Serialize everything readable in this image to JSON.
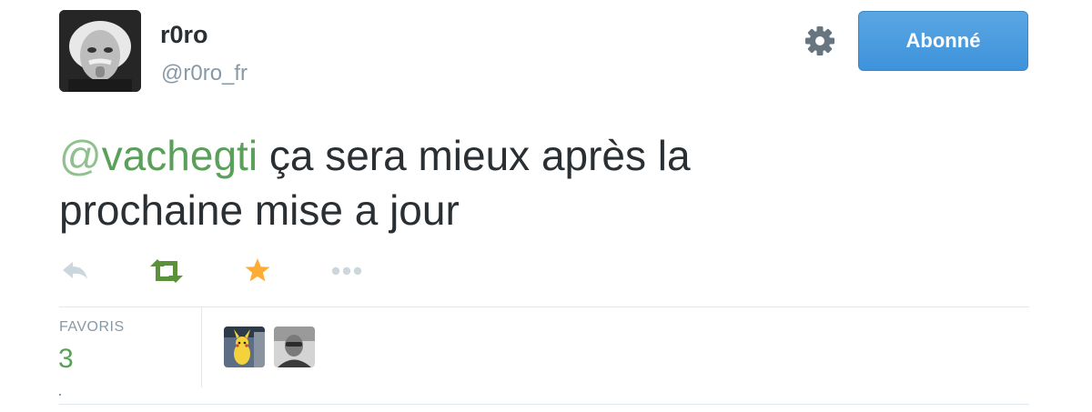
{
  "user": {
    "display_name": "r0ro",
    "screen_name": "@r0ro_fr",
    "avatar_icon": "einstein-avatar"
  },
  "header": {
    "settings_icon": "gear-icon",
    "follow_label": "Abonné"
  },
  "tweet": {
    "mention_at": "@",
    "mention_name": "vachegti",
    "text_line1": " ça sera mieux après la",
    "text_line2": "prochaine mise a jour"
  },
  "actions": [
    {
      "name": "reply",
      "icon": "reply-icon",
      "color": "#ccd6dd"
    },
    {
      "name": "retweet",
      "icon": "retweet-icon",
      "color": "#5c913b"
    },
    {
      "name": "favorite",
      "icon": "star-icon",
      "color": "#ffac33"
    },
    {
      "name": "more",
      "icon": "more-dots-icon",
      "color": "#ccd6dd"
    }
  ],
  "stats": {
    "favorites_label": "FAVORIS",
    "favorites_count": "3"
  },
  "favoriters": [
    {
      "icon": "pikachu-avatar"
    },
    {
      "icon": "person-avatar"
    }
  ],
  "colors": {
    "link": "#5aa05a",
    "button": "#4a9be0",
    "muted": "#8899a6"
  }
}
